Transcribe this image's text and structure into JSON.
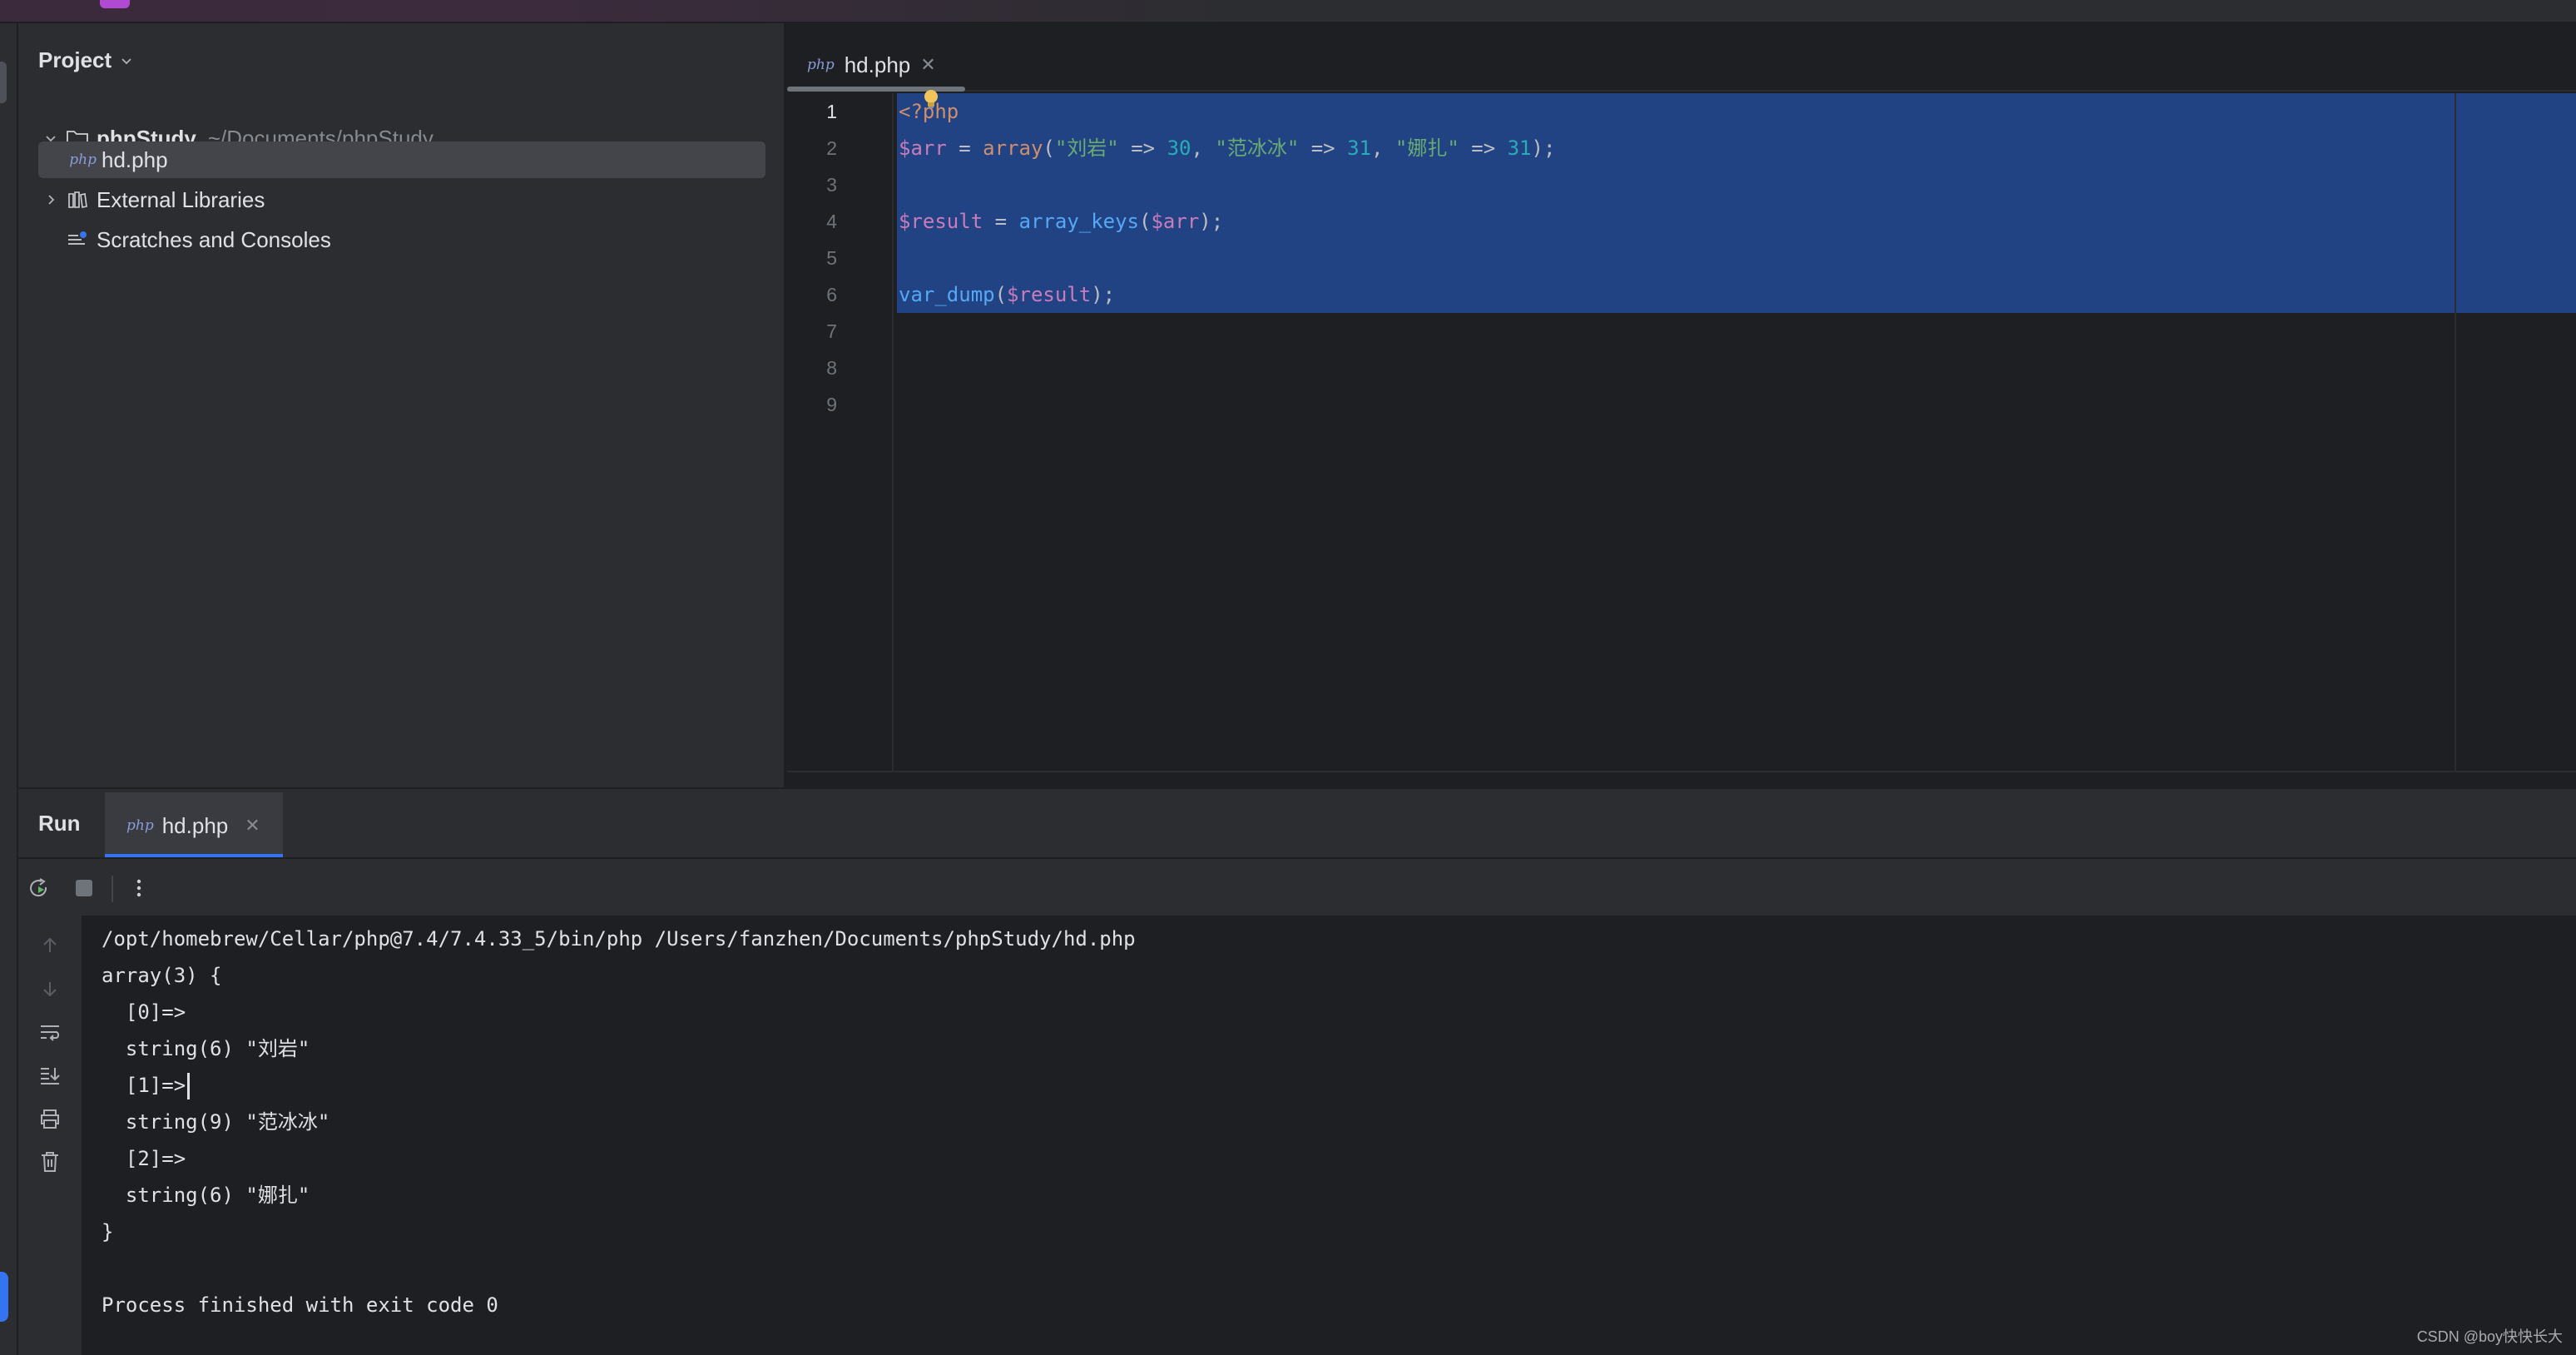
{
  "project": {
    "title": "Project",
    "root": {
      "name": "phpStudy",
      "path": "~/Documents/phpStudy"
    },
    "file": {
      "badge": "php",
      "name": "hd.php"
    },
    "external_libraries": "External Libraries",
    "scratches": "Scratches and Consoles"
  },
  "editor": {
    "tab": {
      "badge": "php",
      "name": "hd.php"
    },
    "line_numbers": [
      "1",
      "2",
      "3",
      "4",
      "5",
      "6",
      "7",
      "8",
      "9"
    ],
    "lines": {
      "l1": "<?php",
      "l2": {
        "var": "$arr",
        "eq": " = ",
        "fn": "array",
        "open": "(",
        "k1": "\"刘岩\"",
        "arrow1": " => ",
        "v1": "30",
        "sep1": ", ",
        "k2": "\"范冰冰\"",
        "arrow2": " => ",
        "v2": "31",
        "sep2": ", ",
        "k3": "\"娜扎\"",
        "arrow3": " => ",
        "v3": "31",
        "close": ");"
      },
      "l4": {
        "var": "$result",
        "eq": " = ",
        "fn": "array_keys",
        "open": "(",
        "arg": "$arr",
        "close": ");"
      },
      "l6": {
        "fn": "var_dump",
        "open": "(",
        "arg": "$result",
        "close": ");"
      }
    }
  },
  "run": {
    "title": "Run",
    "tab": {
      "badge": "php",
      "name": "hd.php"
    },
    "console": {
      "command": "/opt/homebrew/Cellar/php@7.4/7.4.33_5/bin/php /Users/fanzhen/Documents/phpStudy/hd.php",
      "out1": "array(3) {",
      "out2": "  [0]=>",
      "out3": "  string(6) \"刘岩\"",
      "out4": "  [1]=>",
      "out5": "  string(9) \"范冰冰\"",
      "out6": "  [2]=>",
      "out7": "  string(6) \"娜扎\"",
      "out8": "}",
      "out9": "",
      "finish": "Process finished with exit code 0"
    }
  },
  "watermark": "CSDN @boy快快长大",
  "colors": {
    "accent": "#3574f0",
    "selection": "#214283",
    "keyword": "#cf8e6d",
    "variable": "#c77dbb",
    "number": "#2aacb8",
    "string": "#6aab73",
    "function": "#56a8f5"
  }
}
